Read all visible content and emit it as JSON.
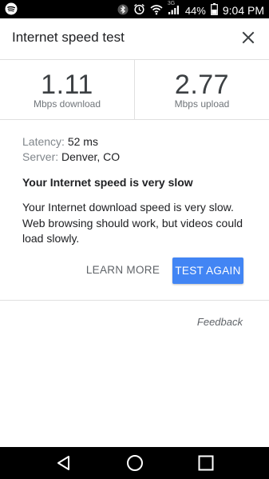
{
  "status_bar": {
    "icons": [
      "spotify-icon",
      "bluetooth-icon",
      "alarm-icon",
      "wifi-icon",
      "signal-icon",
      "battery-icon"
    ],
    "network_label": "3G",
    "battery": "44%",
    "time": "9:04 PM"
  },
  "header": {
    "title": "Internet speed test",
    "close_icon": "close-icon"
  },
  "results": {
    "download": {
      "value": "1.11",
      "label": "Mbps download"
    },
    "upload": {
      "value": "2.77",
      "label": "Mbps upload"
    }
  },
  "details": {
    "latency_key": "Latency:",
    "latency_value": "52 ms",
    "server_key": "Server:",
    "server_value": "Denver, CO"
  },
  "verdict": {
    "title": "Your Internet speed is very slow",
    "body": "Your Internet download speed is very slow. Web browsing should work, but videos could load slowly."
  },
  "actions": {
    "learn_more": "LEARN MORE",
    "test_again": "TEST AGAIN"
  },
  "feedback": "Feedback",
  "colors": {
    "accent": "#4285f4",
    "status_bar": "#000000",
    "nav_bar": "#000000"
  },
  "nav": [
    "back-icon",
    "home-icon",
    "recents-icon"
  ]
}
